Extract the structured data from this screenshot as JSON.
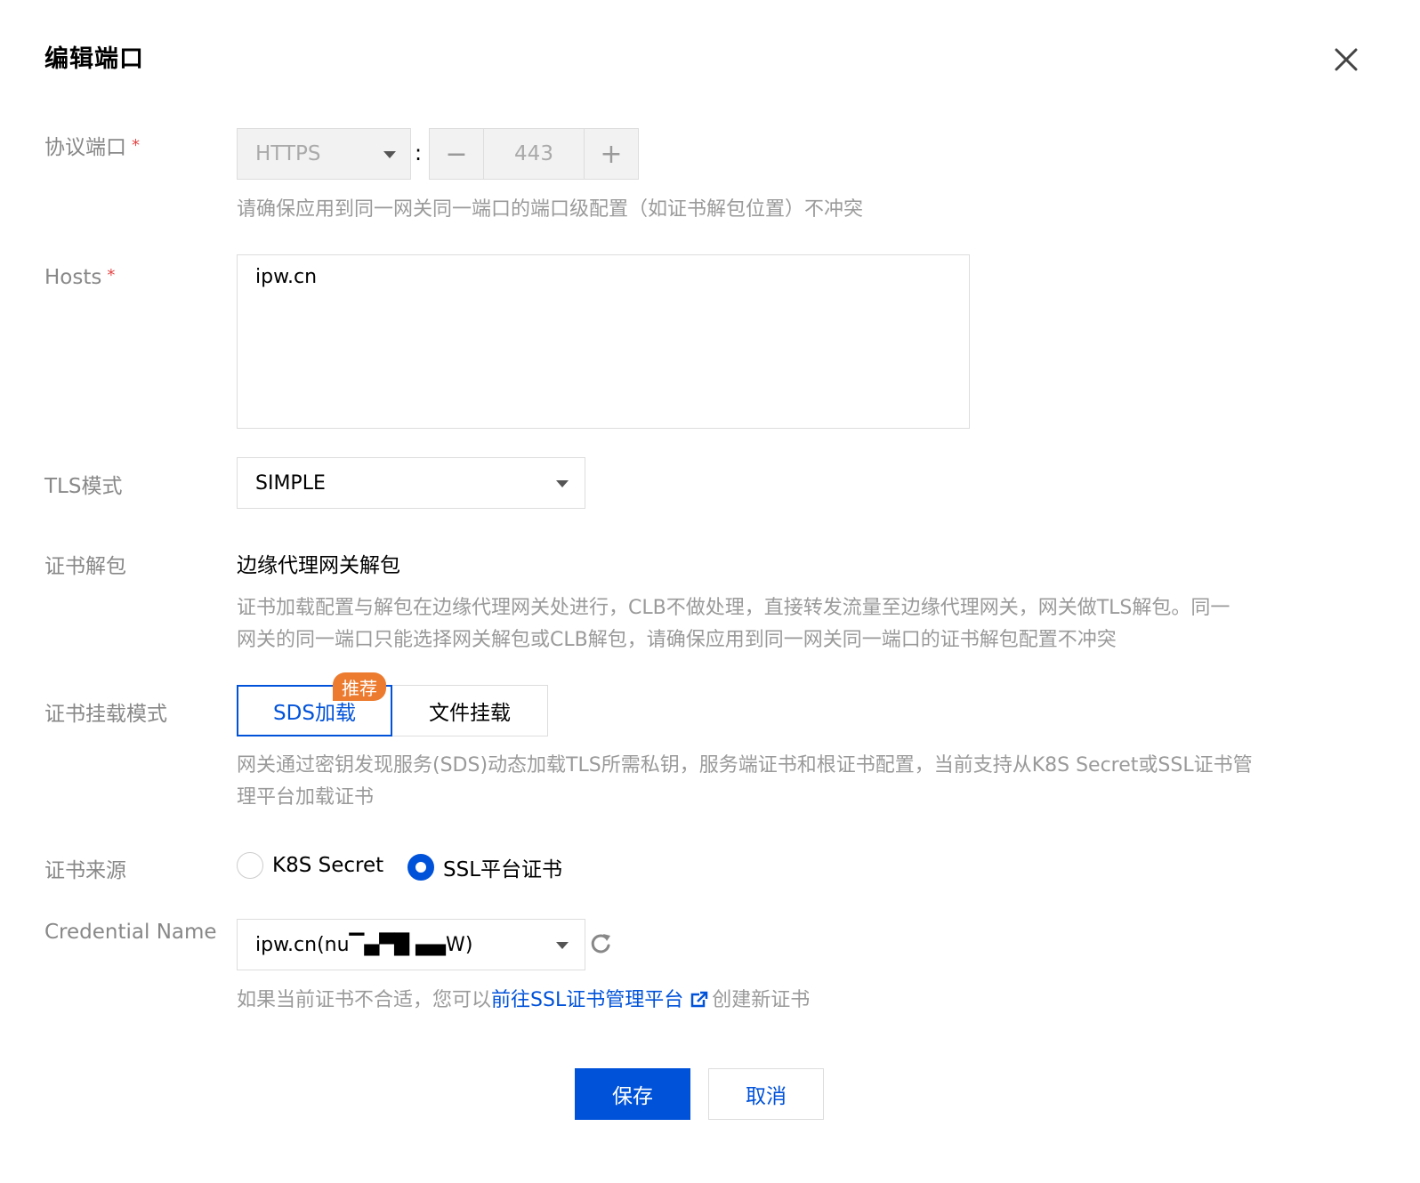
{
  "dialog": {
    "title": "编辑端口"
  },
  "protocol_port": {
    "label": "协议端口",
    "required_mark": "*",
    "protocol": "HTTPS",
    "separator": ":",
    "minus": "−",
    "port": "443",
    "plus": "+",
    "hint": "请确保应用到同一网关同一端口的端口级配置（如证书解包位置）不冲突"
  },
  "hosts": {
    "label": "Hosts",
    "required_mark": "*",
    "value": "ipw.cn"
  },
  "tls_mode": {
    "label": "TLS模式",
    "value": "SIMPLE"
  },
  "cert_unpack": {
    "label": "证书解包",
    "value": "边缘代理网关解包",
    "hint_line1": "证书加载配置与解包在边缘代理网关处进行，CLB不做处理，直接转发流量至边缘代理网关，网关做TLS解包。同一",
    "hint_line2": "网关的同一端口只能选择网关解包或CLB解包，请确保应用到同一网关同一端口的证书解包配置不冲突"
  },
  "mount_mode": {
    "label": "证书挂载模式",
    "options": [
      "SDS加载",
      "文件挂载"
    ],
    "selected": "SDS加载",
    "badge": "推荐",
    "hint_line1": "网关通过密钥发现服务(SDS)动态加载TLS所需私钥，服务端证书和根证书配置，当前支持从K8S Secret或SSL证书管",
    "hint_line2": "理平台加载证书"
  },
  "cert_source": {
    "label": "证书来源",
    "options": [
      "K8S Secret",
      "SSL平台证书"
    ],
    "selected": "SSL平台证书"
  },
  "credential": {
    "label": "Credential Name",
    "value": "ipw.cn(nu▔▄▀█ ▄▄W)",
    "hint_prefix": "如果当前证书不合适，您可以",
    "hint_link": "前往SSL证书管理平台",
    "hint_suffix": "创建新证书"
  },
  "footer": {
    "save": "保存",
    "cancel": "取消"
  },
  "colors": {
    "primary": "#0052d9",
    "badge": "#ed7b2f",
    "required": "#e54545"
  }
}
